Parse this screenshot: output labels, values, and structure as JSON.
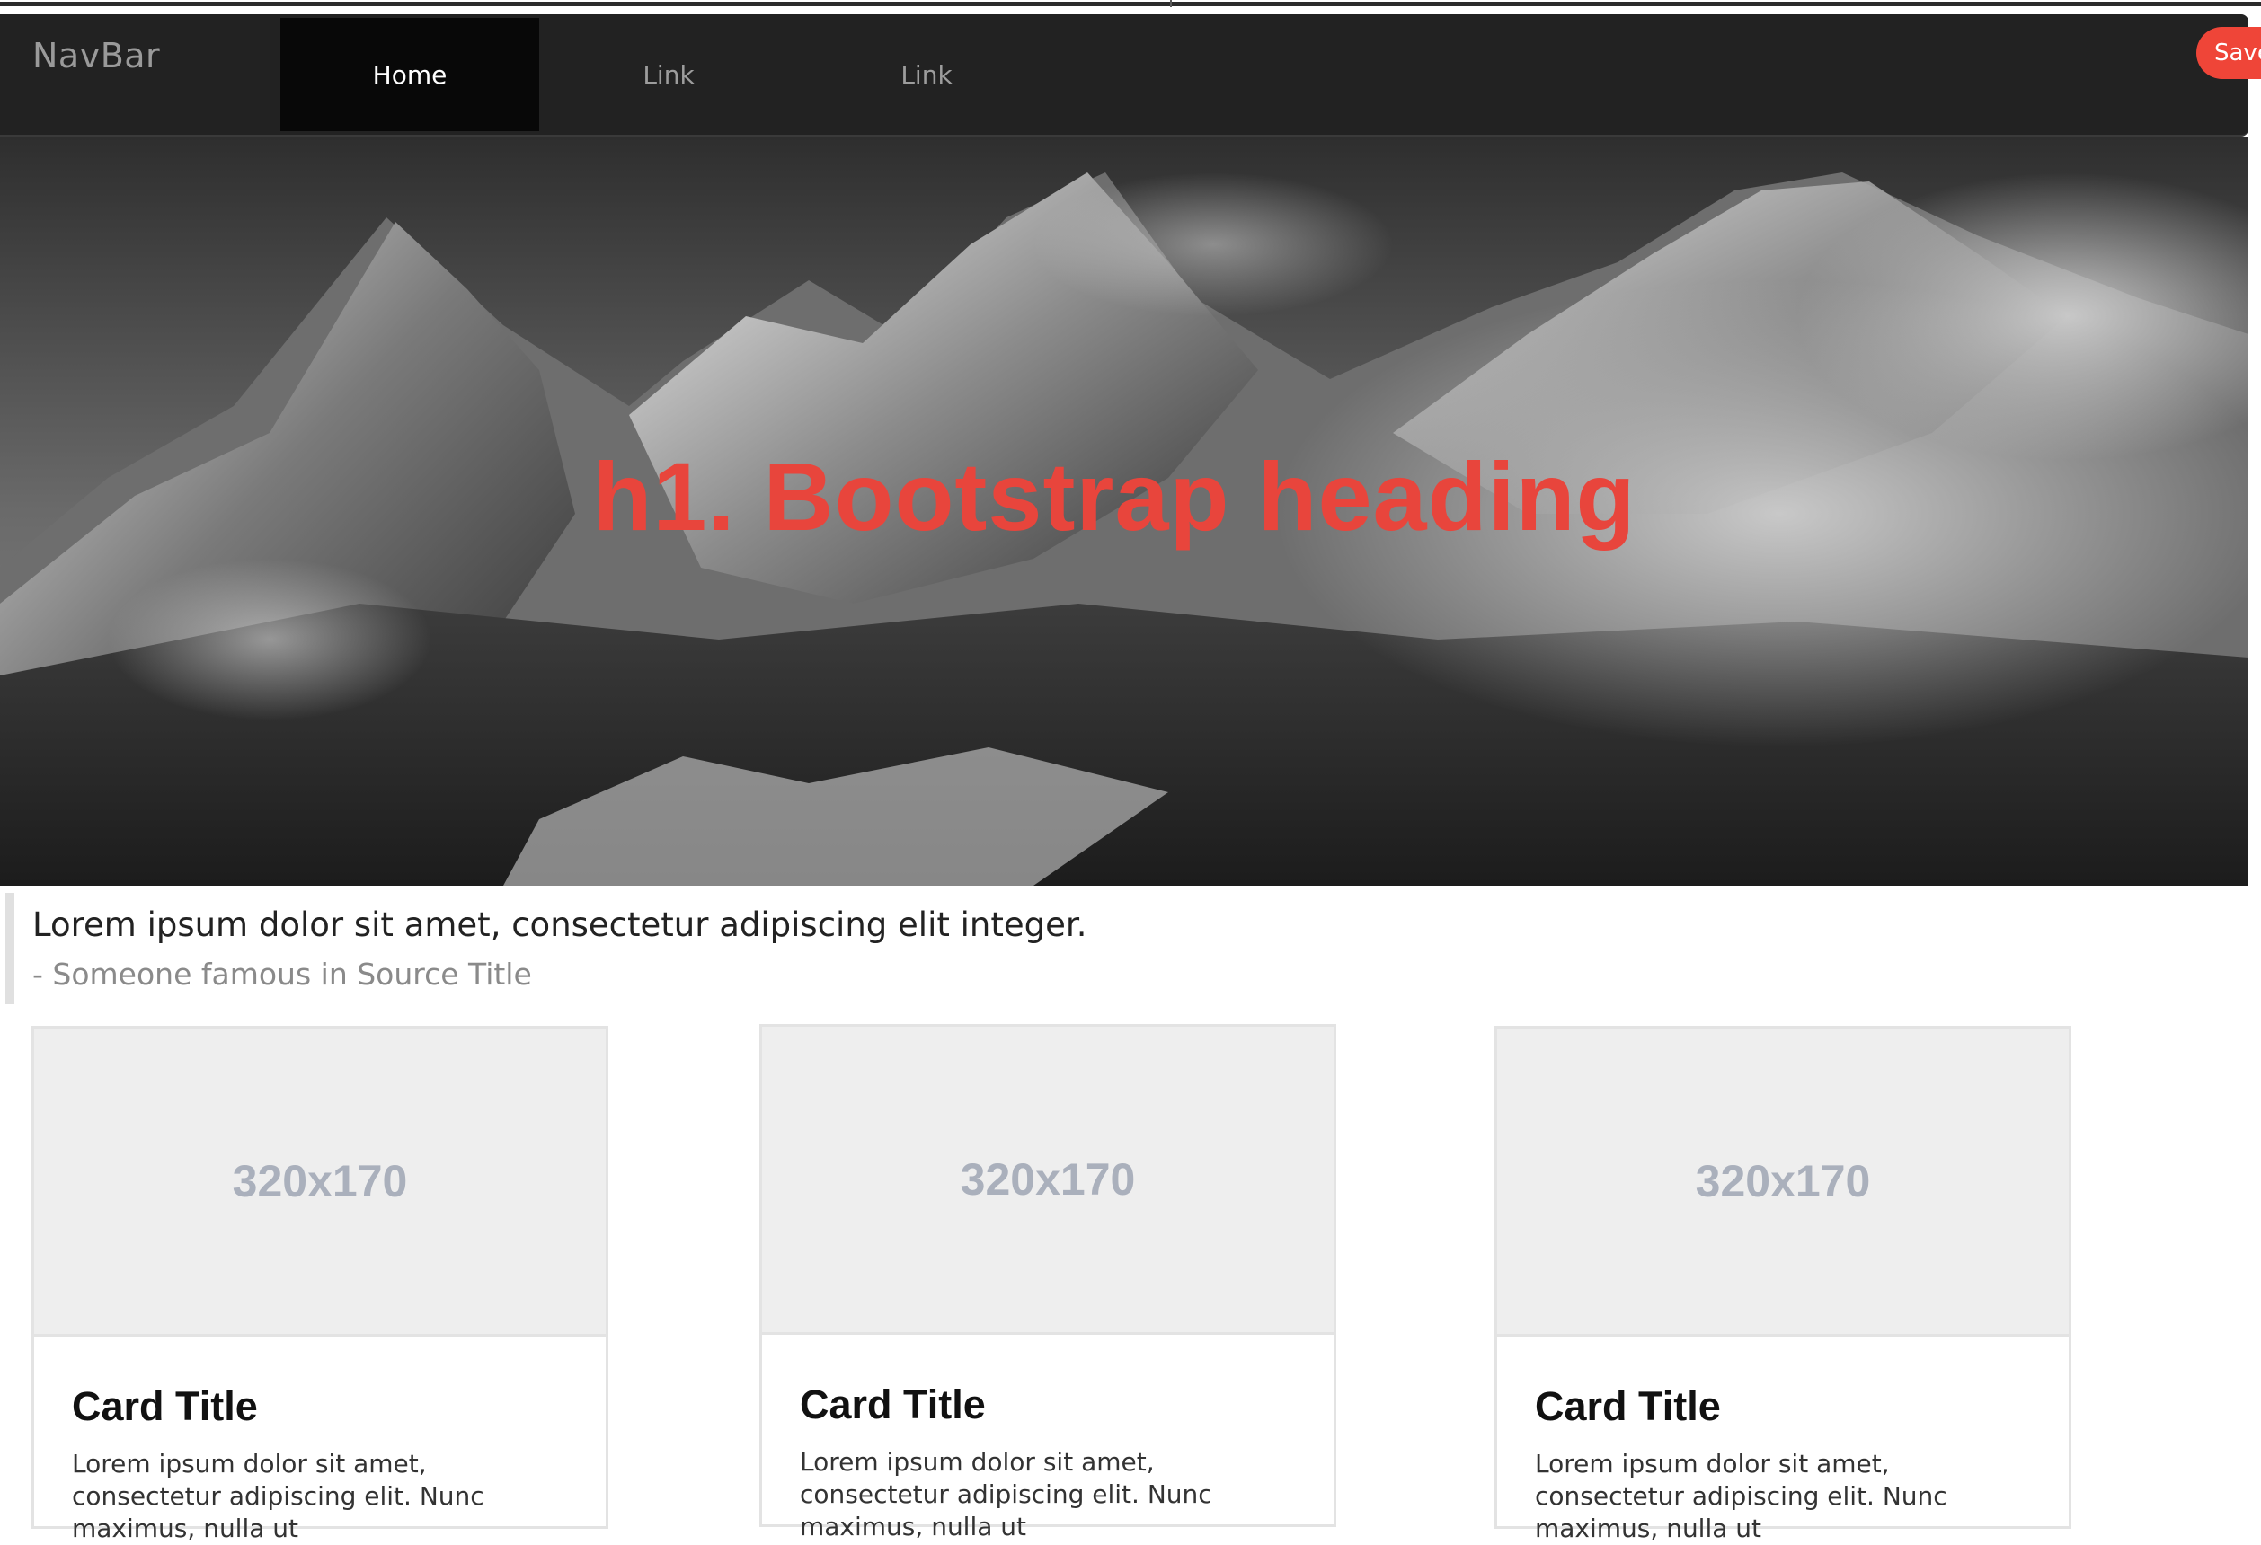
{
  "navbar": {
    "brand": "NavBar",
    "items": [
      {
        "label": "Home",
        "active": true
      },
      {
        "label": "Link",
        "active": false
      },
      {
        "label": "Link",
        "active": false
      }
    ],
    "save_label": "Save"
  },
  "hero": {
    "heading": "h1. Bootstrap heading",
    "heading_color": "#e8453c"
  },
  "quote": {
    "text": "Lorem ipsum dolor sit amet, consectetur adipiscing elit integer.",
    "source": "- Someone famous in Source Title"
  },
  "cards": [
    {
      "image_label": "320x170",
      "title": "Card Title",
      "text": "Lorem ipsum dolor sit amet, consectetur adipiscing elit. Nunc maximus, nulla ut"
    },
    {
      "image_label": "320x170",
      "title": "Card Title",
      "text": "Lorem ipsum dolor sit amet, consectetur adipiscing elit. Nunc maximus, nulla ut"
    },
    {
      "image_label": "320x170",
      "title": "Card Title",
      "text": "Lorem ipsum dolor sit amet, consectetur adipiscing elit. Nunc maximus, nulla ut"
    }
  ],
  "colors": {
    "navbar_bg": "#222222",
    "accent": "#ef4538",
    "placeholder_text": "#aab0bc"
  }
}
